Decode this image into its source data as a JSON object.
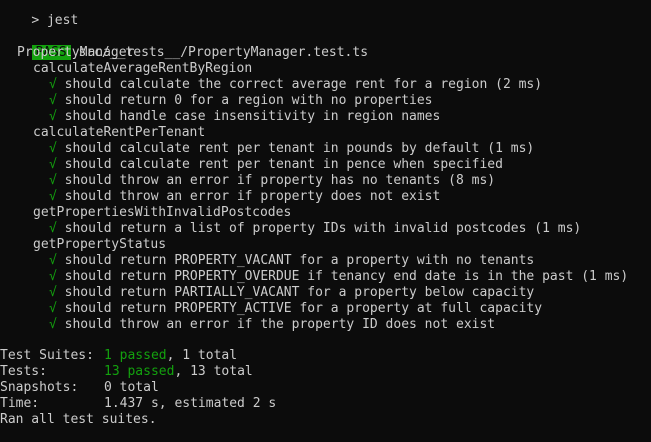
{
  "prompt": {
    "symbol": ">",
    "command": "jest"
  },
  "result": {
    "badge": "PASS",
    "file": "src/__tests__/PropertyManager.test.ts",
    "suite": "PropertyManager",
    "check_mark": "√",
    "groups": [
      {
        "name": "calculateAverageRentByRegion",
        "tests": [
          "should calculate the correct average rent for a region (2 ms)",
          "should return 0 for a region with no properties",
          "should handle case insensitivity in region names"
        ]
      },
      {
        "name": "calculateRentPerTenant",
        "tests": [
          "should calculate rent per tenant in pounds by default (1 ms)",
          "should calculate rent per tenant in pence when specified",
          "should throw an error if property has no tenants (8 ms)",
          "should throw an error if property does not exist"
        ]
      },
      {
        "name": "getPropertiesWithInvalidPostcodes",
        "tests": [
          "should return a list of property IDs with invalid postcodes (1 ms)"
        ]
      },
      {
        "name": "getPropertyStatus",
        "tests": [
          "should return PROPERTY_VACANT for a property with no tenants",
          "should return PROPERTY_OVERDUE if tenancy end date is in the past (1 ms)",
          "should return PARTIALLY_VACANT for a property below capacity",
          "should return PROPERTY_ACTIVE for a property at full capacity",
          "should throw an error if the property ID does not exist"
        ]
      }
    ]
  },
  "summary": {
    "suites_label": "Test Suites:",
    "suites_passed": "1 passed",
    "suites_total": ", 1 total",
    "tests_label": "Tests:",
    "tests_passed": "13 passed",
    "tests_total": ", 13 total",
    "snapshots_label": "Snapshots:",
    "snapshots_value": "0 total",
    "time_label": "Time:",
    "time_value": "1.437 s, estimated 2 s",
    "footer": "Ran all test suites."
  },
  "colors": {
    "background": "#0c0c0c",
    "text": "#cccccc",
    "pass_green": "#13a10e"
  }
}
